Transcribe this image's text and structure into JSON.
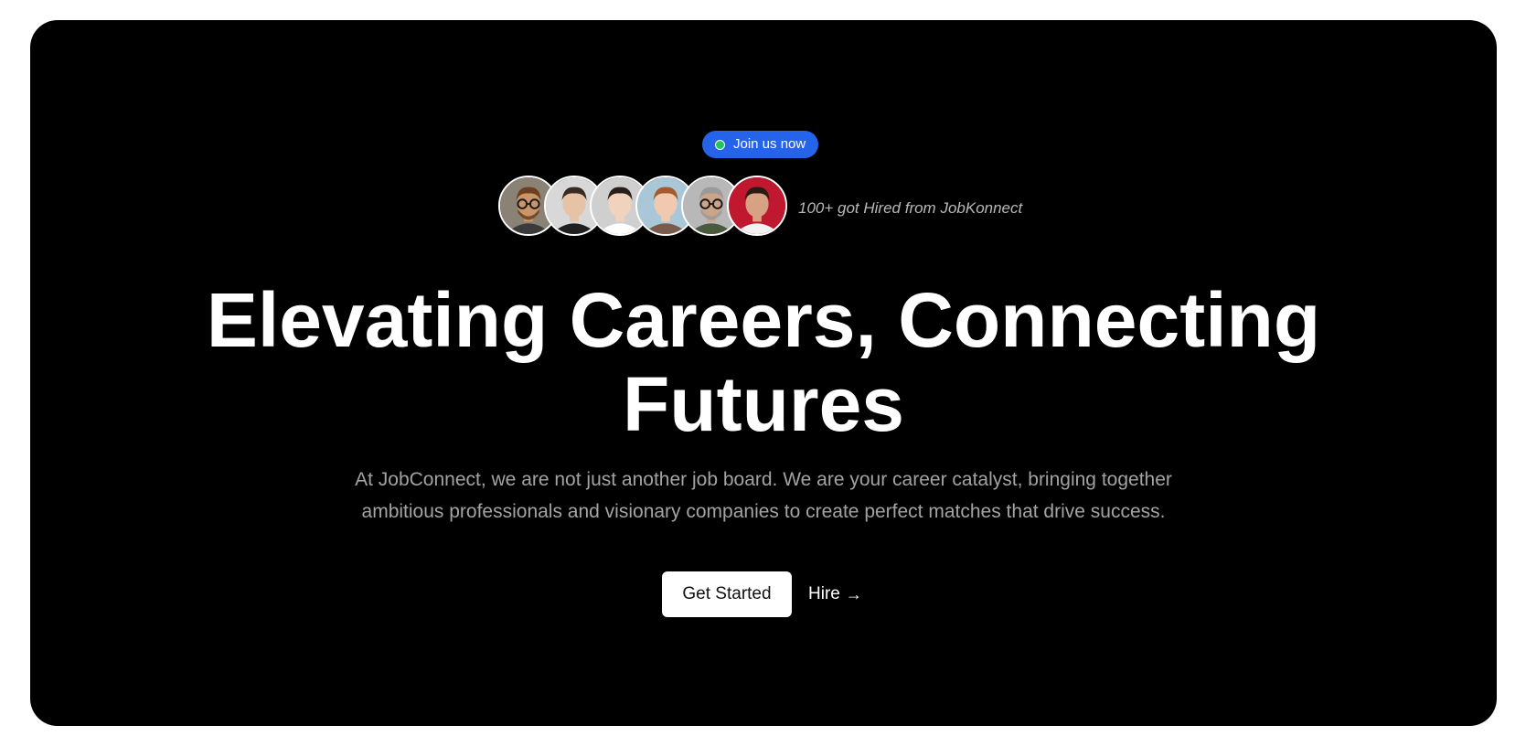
{
  "badge": {
    "label": "Join us now",
    "accent_color": "#2563eb",
    "dot_color": "#22c55e",
    "dot_icon": "status-dot-icon"
  },
  "social_proof": {
    "avatars": [
      {
        "name": "avatar-1",
        "skin": "#c9956b",
        "hair": "#6b3f1f",
        "bg": "#8a8275",
        "shirt": "#3b3b3b",
        "glasses": true,
        "beard": true
      },
      {
        "name": "avatar-2",
        "skin": "#e6c2a6",
        "hair": "#3a2a20",
        "bg": "#d8d8d8",
        "shirt": "#1f1f1f",
        "glasses": false,
        "beard": false
      },
      {
        "name": "avatar-3",
        "skin": "#f0d2bd",
        "hair": "#2a1e18",
        "bg": "#cfcfcf",
        "shirt": "#ffffff",
        "glasses": false,
        "beard": false
      },
      {
        "name": "avatar-4",
        "skin": "#f1c8b0",
        "hair": "#a35a2c",
        "bg": "#a9c7d6",
        "shirt": "#7a5a4a",
        "glasses": false,
        "beard": false
      },
      {
        "name": "avatar-5",
        "skin": "#caa589",
        "hair": "#9a9a9a",
        "bg": "#b8b8b8",
        "shirt": "#4a5a3c",
        "glasses": true,
        "beard": true
      },
      {
        "name": "avatar-6",
        "skin": "#d7a184",
        "hair": "#2b1a14",
        "bg": "#c0192f",
        "shirt": "#f2f2f2",
        "glasses": false,
        "beard": false
      }
    ],
    "text": "100+ got Hired from JobKonnect"
  },
  "hero": {
    "headline_line1": "Elevating Careers, Connecting",
    "headline_line2": "Futures",
    "subtitle_line1": "At JobConnect, we are not just another job board. We are your career catalyst, bringing together",
    "subtitle_line2": "ambitious professionals and visionary companies to create perfect matches that drive success."
  },
  "actions": {
    "primary_label": "Get Started",
    "secondary_label": "Hire",
    "secondary_icon": "arrow-right-icon",
    "secondary_arrow": "→"
  }
}
